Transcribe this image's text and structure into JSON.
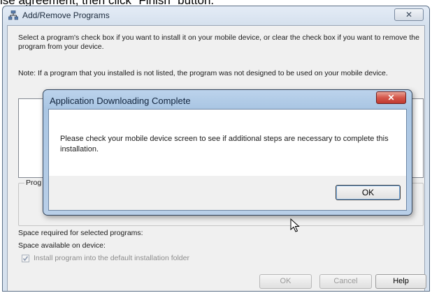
{
  "doc_text": "ise agreement, then click “Finish” button.",
  "main_window": {
    "title": "Add/Remove Programs",
    "close_glyph": "✕",
    "instruction": "Select a program's check box if you want to install it on your mobile device, or clear the check box if you want to remove the program from your device.",
    "note": "Note:  If a program that you installed is not listed, the program was not designed to be used on your mobile device.",
    "group_label": "Prog",
    "space_required_label": "Space required for selected programs:",
    "space_available_label": "Space available on device:",
    "default_folder_label": "Install program into the default installation folder",
    "default_folder_checked": true,
    "ok_label": "OK",
    "cancel_label": "Cancel",
    "help_label": "Help"
  },
  "dialog": {
    "title": "Application Downloading Complete",
    "close_glyph": "✕",
    "message": "Please check your mobile device screen to see if additional steps are necessary to complete this installation.",
    "ok_label": "OK"
  },
  "icons": {
    "app": "network-computers-icon",
    "cursor": "mouse-pointer-icon",
    "check": "checkmark-icon"
  }
}
